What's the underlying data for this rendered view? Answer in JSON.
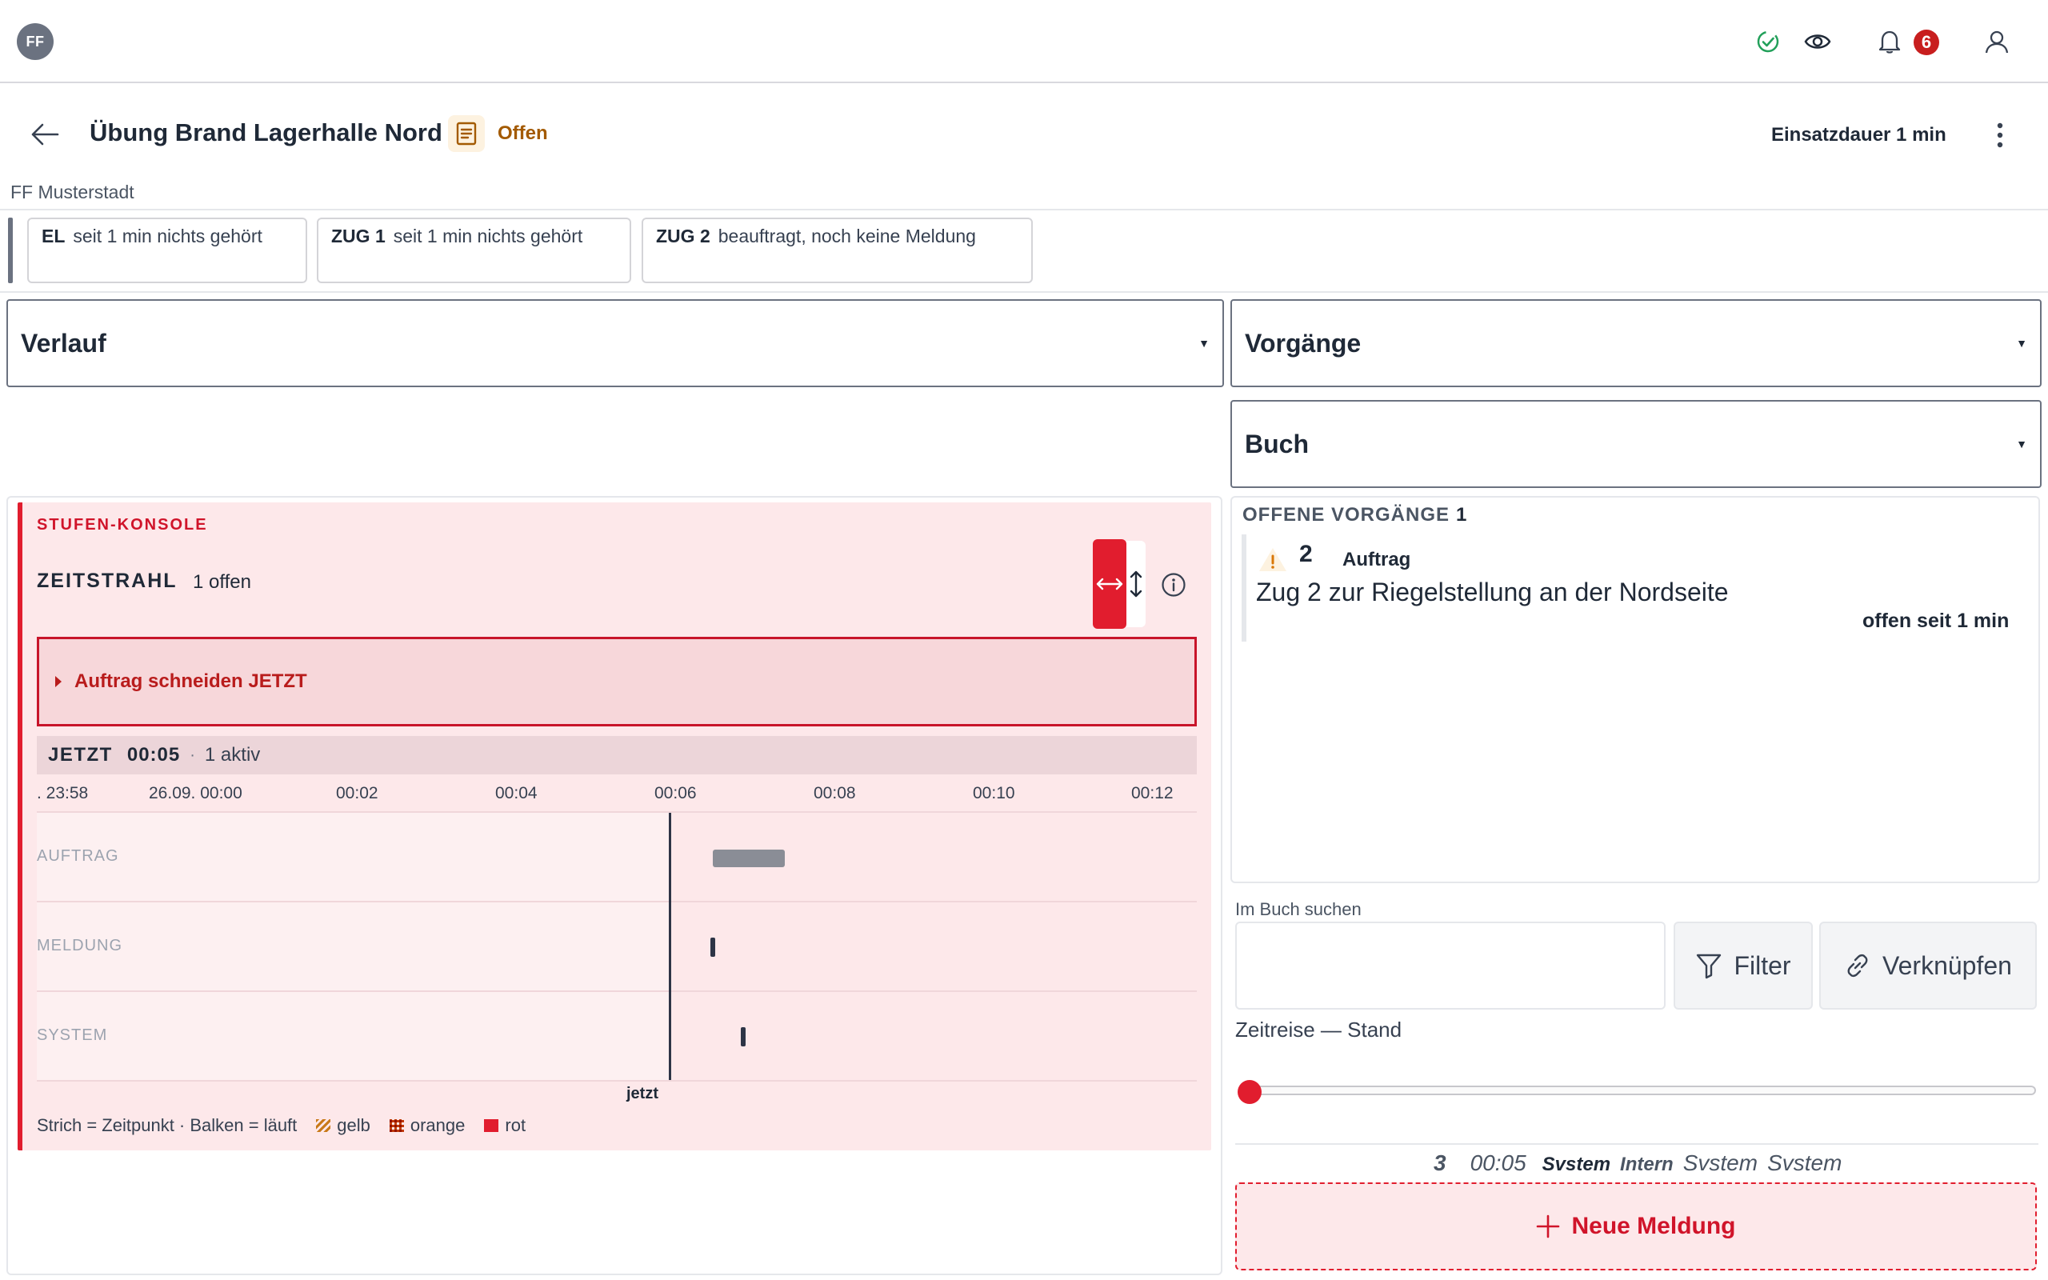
{
  "app": {
    "logo_text": "FF",
    "notifications_count": "6",
    "icons": [
      "check-circle-icon",
      "eye-icon",
      "bell-icon",
      "user-icon"
    ]
  },
  "header": {
    "title": "Übung Brand Lagerhalle Nord",
    "status": "Offen",
    "duration": "Einsatzdauer 1 min",
    "organization": "FF Musterstadt"
  },
  "units": [
    {
      "code": "EL",
      "status": "seit 1 min nichts gehört"
    },
    {
      "code": "ZUG 1",
      "status": "seit 1 min nichts gehört"
    },
    {
      "code": "ZUG 2",
      "status": "beauftragt, noch keine Meldung"
    }
  ],
  "selects": {
    "left": "Verlauf",
    "right_top": "Vorgänge",
    "right_bottom": "Buch"
  },
  "console": {
    "kicker": "STUFEN-KONSOLE",
    "title": "ZEITSTRAHL",
    "open_count": "1 offen",
    "alert": "Auftrag schneiden JETZT",
    "now_label": "JETZT",
    "now_time": "00:05",
    "separator": "·",
    "active": "1 aktiv",
    "ticks": [
      ". 23:58",
      "26.09. 00:00",
      "00:02",
      "00:04",
      "00:06",
      "00:08",
      "00:10",
      "00:12"
    ],
    "lanes": [
      "AUFTRAG",
      "MELDUNG",
      "SYSTEM"
    ],
    "now_caption": "jetzt",
    "legend_text": "Strich = Zeitpunkt · Balken = läuft",
    "legend_items": [
      "gelb",
      "orange",
      "rot"
    ],
    "colors": {
      "accent": "#e11d2e",
      "console_bg": "#fde8ea",
      "gelb": "#c97a1a",
      "orange": "#c2410c",
      "rot": "#e11d2e"
    }
  },
  "open_tasks": {
    "title": "OFFENE VORGÄNGE",
    "count": "1",
    "entry": {
      "number": "2",
      "type": "Auftrag",
      "text": "Zug 2 zur Riegelstellung an der Nordseite",
      "since": "offen seit 1 min"
    }
  },
  "book": {
    "search_label": "Im Buch suchen",
    "search_value": "",
    "filter_label": "Filter",
    "link_label": "Verknüpfen",
    "timetravel_label": "Zeitreise — Stand",
    "slider_position": 0,
    "feed": {
      "number": "3",
      "time": "00:05",
      "sender": "Svstem",
      "channel": "Intern",
      "from": "Svstem",
      "to": "Svstem"
    },
    "new_message": "Neue Meldung"
  }
}
